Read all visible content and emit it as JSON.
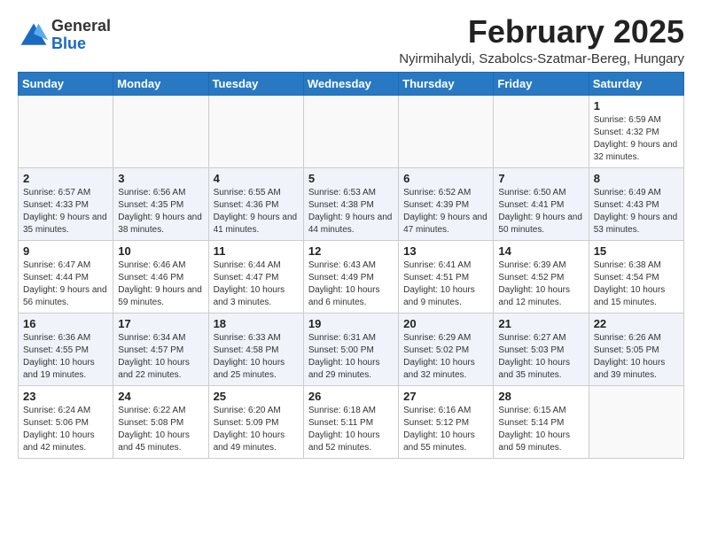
{
  "logo": {
    "general": "General",
    "blue": "Blue"
  },
  "title": "February 2025",
  "subtitle": "Nyirmihalydi, Szabolcs-Szatmar-Bereg, Hungary",
  "headers": [
    "Sunday",
    "Monday",
    "Tuesday",
    "Wednesday",
    "Thursday",
    "Friday",
    "Saturday"
  ],
  "weeks": [
    [
      {
        "day": "",
        "info": ""
      },
      {
        "day": "",
        "info": ""
      },
      {
        "day": "",
        "info": ""
      },
      {
        "day": "",
        "info": ""
      },
      {
        "day": "",
        "info": ""
      },
      {
        "day": "",
        "info": ""
      },
      {
        "day": "1",
        "info": "Sunrise: 6:59 AM\nSunset: 4:32 PM\nDaylight: 9 hours and 32 minutes."
      }
    ],
    [
      {
        "day": "2",
        "info": "Sunrise: 6:57 AM\nSunset: 4:33 PM\nDaylight: 9 hours and 35 minutes."
      },
      {
        "day": "3",
        "info": "Sunrise: 6:56 AM\nSunset: 4:35 PM\nDaylight: 9 hours and 38 minutes."
      },
      {
        "day": "4",
        "info": "Sunrise: 6:55 AM\nSunset: 4:36 PM\nDaylight: 9 hours and 41 minutes."
      },
      {
        "day": "5",
        "info": "Sunrise: 6:53 AM\nSunset: 4:38 PM\nDaylight: 9 hours and 44 minutes."
      },
      {
        "day": "6",
        "info": "Sunrise: 6:52 AM\nSunset: 4:39 PM\nDaylight: 9 hours and 47 minutes."
      },
      {
        "day": "7",
        "info": "Sunrise: 6:50 AM\nSunset: 4:41 PM\nDaylight: 9 hours and 50 minutes."
      },
      {
        "day": "8",
        "info": "Sunrise: 6:49 AM\nSunset: 4:43 PM\nDaylight: 9 hours and 53 minutes."
      }
    ],
    [
      {
        "day": "9",
        "info": "Sunrise: 6:47 AM\nSunset: 4:44 PM\nDaylight: 9 hours and 56 minutes."
      },
      {
        "day": "10",
        "info": "Sunrise: 6:46 AM\nSunset: 4:46 PM\nDaylight: 9 hours and 59 minutes."
      },
      {
        "day": "11",
        "info": "Sunrise: 6:44 AM\nSunset: 4:47 PM\nDaylight: 10 hours and 3 minutes."
      },
      {
        "day": "12",
        "info": "Sunrise: 6:43 AM\nSunset: 4:49 PM\nDaylight: 10 hours and 6 minutes."
      },
      {
        "day": "13",
        "info": "Sunrise: 6:41 AM\nSunset: 4:51 PM\nDaylight: 10 hours and 9 minutes."
      },
      {
        "day": "14",
        "info": "Sunrise: 6:39 AM\nSunset: 4:52 PM\nDaylight: 10 hours and 12 minutes."
      },
      {
        "day": "15",
        "info": "Sunrise: 6:38 AM\nSunset: 4:54 PM\nDaylight: 10 hours and 15 minutes."
      }
    ],
    [
      {
        "day": "16",
        "info": "Sunrise: 6:36 AM\nSunset: 4:55 PM\nDaylight: 10 hours and 19 minutes."
      },
      {
        "day": "17",
        "info": "Sunrise: 6:34 AM\nSunset: 4:57 PM\nDaylight: 10 hours and 22 minutes."
      },
      {
        "day": "18",
        "info": "Sunrise: 6:33 AM\nSunset: 4:58 PM\nDaylight: 10 hours and 25 minutes."
      },
      {
        "day": "19",
        "info": "Sunrise: 6:31 AM\nSunset: 5:00 PM\nDaylight: 10 hours and 29 minutes."
      },
      {
        "day": "20",
        "info": "Sunrise: 6:29 AM\nSunset: 5:02 PM\nDaylight: 10 hours and 32 minutes."
      },
      {
        "day": "21",
        "info": "Sunrise: 6:27 AM\nSunset: 5:03 PM\nDaylight: 10 hours and 35 minutes."
      },
      {
        "day": "22",
        "info": "Sunrise: 6:26 AM\nSunset: 5:05 PM\nDaylight: 10 hours and 39 minutes."
      }
    ],
    [
      {
        "day": "23",
        "info": "Sunrise: 6:24 AM\nSunset: 5:06 PM\nDaylight: 10 hours and 42 minutes."
      },
      {
        "day": "24",
        "info": "Sunrise: 6:22 AM\nSunset: 5:08 PM\nDaylight: 10 hours and 45 minutes."
      },
      {
        "day": "25",
        "info": "Sunrise: 6:20 AM\nSunset: 5:09 PM\nDaylight: 10 hours and 49 minutes."
      },
      {
        "day": "26",
        "info": "Sunrise: 6:18 AM\nSunset: 5:11 PM\nDaylight: 10 hours and 52 minutes."
      },
      {
        "day": "27",
        "info": "Sunrise: 6:16 AM\nSunset: 5:12 PM\nDaylight: 10 hours and 55 minutes."
      },
      {
        "day": "28",
        "info": "Sunrise: 6:15 AM\nSunset: 5:14 PM\nDaylight: 10 hours and 59 minutes."
      },
      {
        "day": "",
        "info": ""
      }
    ]
  ]
}
